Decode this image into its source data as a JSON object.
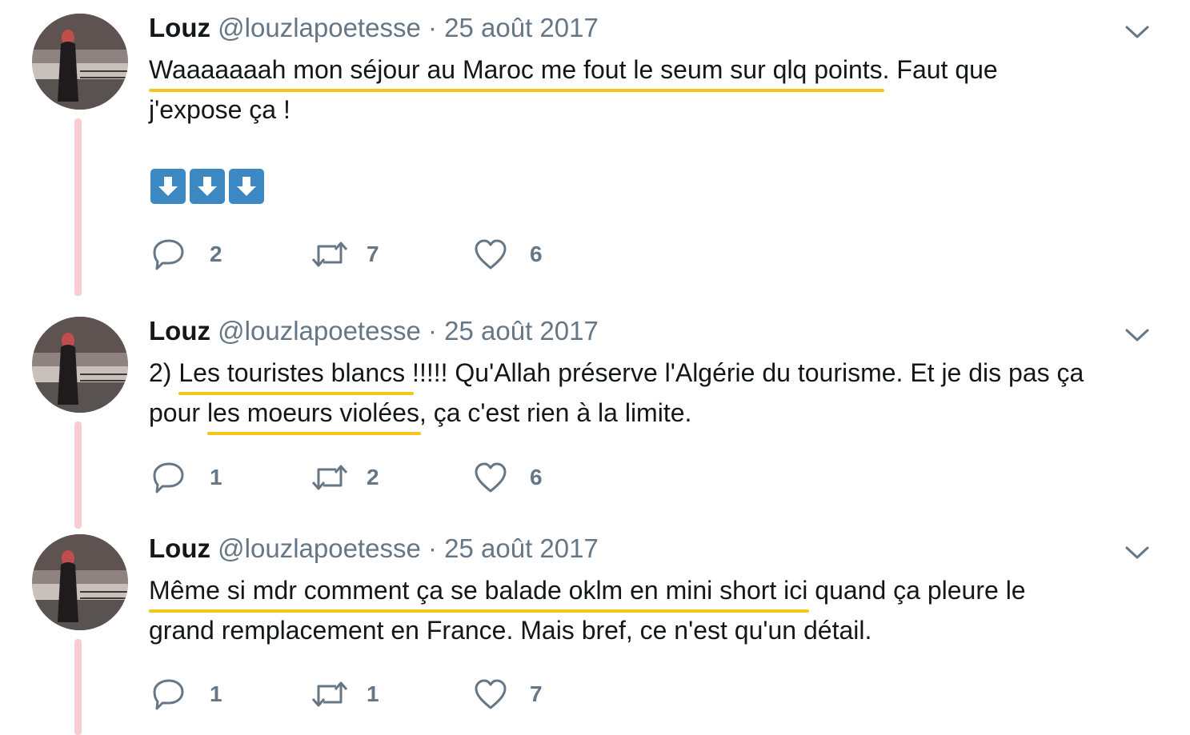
{
  "tweets": [
    {
      "author_name": "Louz",
      "handle": "@louzlapoetesse",
      "separator": "·",
      "date": "25 août 2017",
      "text_line1_underlined": "Waaaaaaah mon séjour au Maroc me fout le seum sur qlq points",
      "text_line1_rest": ". Faut que",
      "text_line2": "j'expose ça !",
      "emojis": [
        "down-arrow-emoji",
        "down-arrow-emoji",
        "down-arrow-emoji"
      ],
      "replies": "2",
      "retweets": "7",
      "likes": "6"
    },
    {
      "author_name": "Louz",
      "handle": "@louzlapoetesse",
      "separator": "·",
      "date": "25 août 2017",
      "text_line1_prefix": "2) ",
      "text_line1_underlined": "Les touristes blancs ",
      "text_line1_rest": "!!!!! Qu'Allah préserve l'Algérie du tourisme. Et je dis pas ça",
      "text_line2_prefix": "pour ",
      "text_line2_underlined": "les moeurs violées",
      "text_line2_rest": ", ça c'est rien à la limite.",
      "replies": "1",
      "retweets": "2",
      "likes": "6"
    },
    {
      "author_name": "Louz",
      "handle": "@louzlapoetesse",
      "separator": "·",
      "date": "25 août 2017",
      "text_line1_underlined": "Même si mdr comment ça se balade oklm en mini short ici",
      "text_line1_rest": " quand ça pleure le",
      "text_line2": "grand remplacement en France. Mais bref, ce n'est qu'un détail.",
      "replies": "1",
      "retweets": "1",
      "likes": "7"
    }
  ],
  "colors": {
    "highlight": "#f5c518",
    "thread_line": "#f9cbd3",
    "muted": "#657786",
    "emoji_blue": "#3b88c3"
  }
}
